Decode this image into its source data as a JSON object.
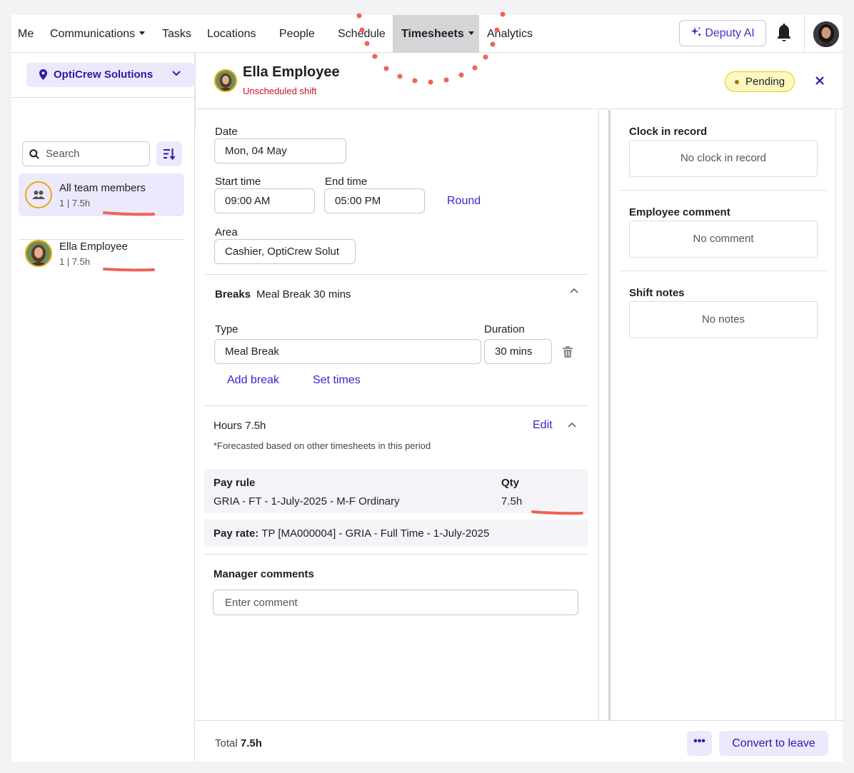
{
  "nav": {
    "items": [
      {
        "label": "Me"
      },
      {
        "label": "Communications"
      },
      {
        "label": "Tasks"
      },
      {
        "label": "Locations"
      },
      {
        "label": "People"
      },
      {
        "label": "Schedule"
      },
      {
        "label": "Timesheets"
      },
      {
        "label": "Analytics"
      }
    ],
    "active": "Timesheets",
    "ai_label": "Deputy AI",
    "icons": [
      "sparkle-icon",
      "bell-icon",
      "user-avatar"
    ]
  },
  "sidebar": {
    "location": "OptiCrew Solutions",
    "search_placeholder": "Search",
    "members": [
      {
        "name": "All team members",
        "sub": "1 | 7.5h",
        "selected": true
      },
      {
        "name": "Ella Employee",
        "sub": "1 | 7.5h",
        "selected": false
      }
    ]
  },
  "shift": {
    "employee": "Ella Employee",
    "subtitle": "Unscheduled shift",
    "status": "Pending",
    "date_label": "Date",
    "date": "Mon, 04 May",
    "start_label": "Start time",
    "start": "09:00 AM",
    "end_label": "End time",
    "end": "05:00 PM",
    "round_label": "Round",
    "area_label": "Area",
    "area": "Cashier, OptiCrew Solut",
    "breaks": {
      "title": "Breaks",
      "summary": "Meal Break 30 mins",
      "type_label": "Type",
      "type": "Meal Break",
      "duration_label": "Duration",
      "duration": "30 mins",
      "add_label": "Add break",
      "set_times_label": "Set times"
    },
    "hours": {
      "title": "Hours",
      "value": "7.5h",
      "edit_label": "Edit",
      "note": "*Forecasted based on other timesheets in this period",
      "pay_rule_header": "Pay rule",
      "qty_header": "Qty",
      "pay_rule": "GRIA - FT - 1-July-2025 - M-F Ordinary",
      "qty": "7.5h",
      "pay_rate_label": "Pay rate:",
      "pay_rate": "TP [MA000004] - GRIA - Full Time - 1-July-2025"
    },
    "manager": {
      "title": "Manager comments",
      "placeholder": "Enter comment"
    }
  },
  "right": {
    "clock_title": "Clock in record",
    "clock_value": "No clock in record",
    "comment_title": "Employee comment",
    "comment_value": "No comment",
    "notes_title": "Shift notes",
    "notes_value": "No notes"
  },
  "footer": {
    "total_label": "Total",
    "total_value": "7.5h",
    "more_label": "•••",
    "convert_label": "Convert to leave"
  },
  "colors": {
    "accent": "#3b24c8",
    "accent_bg": "#ebe9fb",
    "pending_bg": "#fff7c2",
    "alert": "#c8102e",
    "annotation": "#f0635a"
  }
}
